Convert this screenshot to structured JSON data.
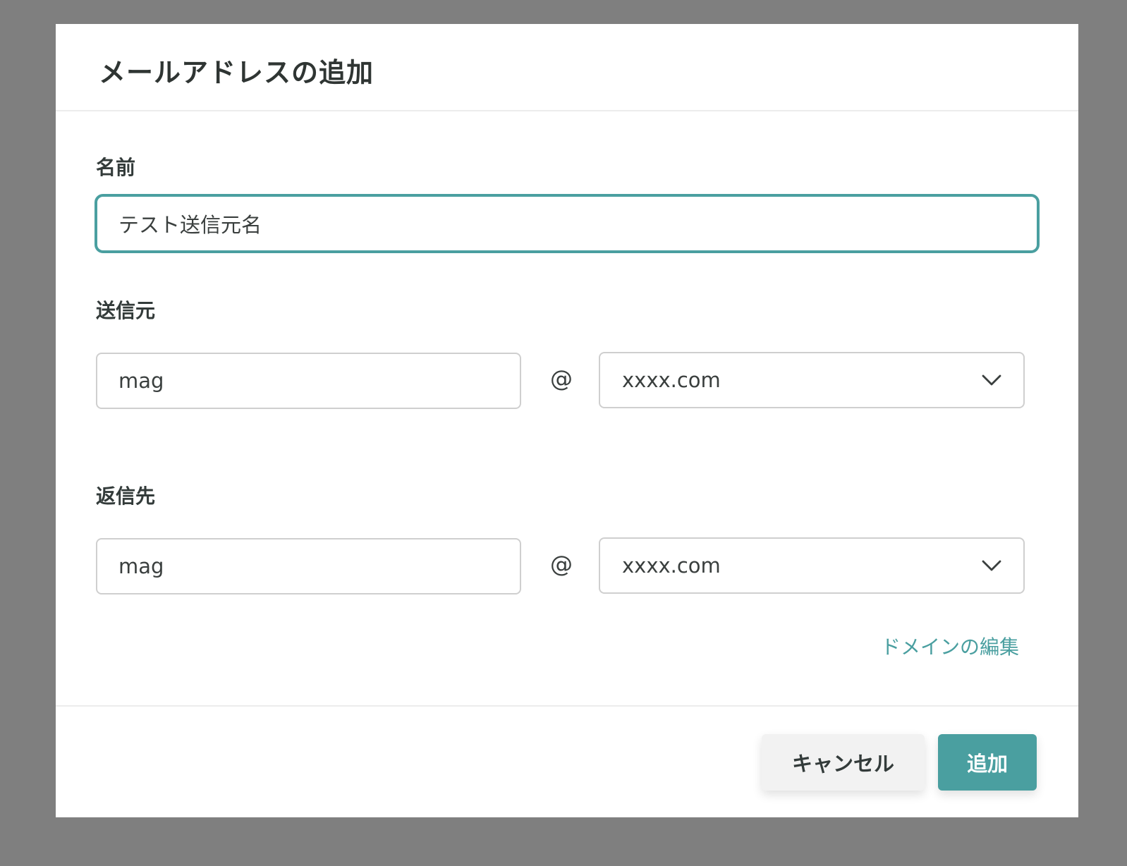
{
  "dialog": {
    "title": "メールアドレスの追加"
  },
  "name_field": {
    "label": "名前",
    "value": "テスト送信元名"
  },
  "sender": {
    "label": "送信元",
    "local_value": "mag",
    "at": "@",
    "domain_selected": "xxxx.com"
  },
  "reply_to": {
    "label": "返信先",
    "local_value": "mag",
    "at": "@",
    "domain_selected": "xxxx.com"
  },
  "edit_domain_link": "ドメインの編集",
  "footer": {
    "cancel_label": "キャンセル",
    "add_label": "追加"
  },
  "colors": {
    "accent": "#4a9fa0",
    "overlay": "#7f7f7f",
    "border": "#cfcfcf"
  },
  "icons": {
    "select_chevron": "chevron-down-icon"
  }
}
